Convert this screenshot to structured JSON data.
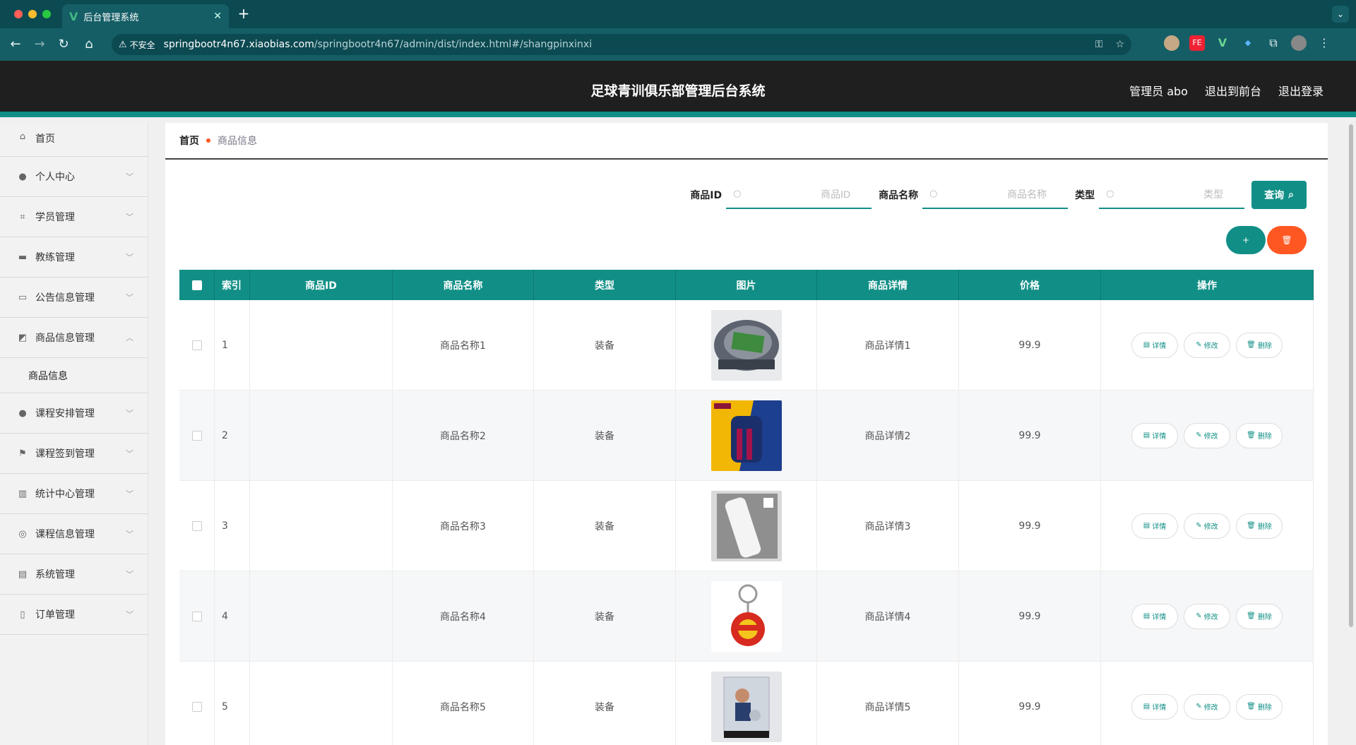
{
  "browser": {
    "tab_title": "后台管理系统",
    "insecure_label": "不安全",
    "url_host": "springbootr4n67.xiaobias.com",
    "url_path": "/springbootr4n67/admin/dist/index.html#/shangpinxinxi"
  },
  "header": {
    "title": "足球青训俱乐部管理后台系统",
    "user": "管理员 abo",
    "to_front": "退出到前台",
    "logout": "退出登录"
  },
  "sidebar": {
    "items": [
      {
        "label": "首页",
        "icon": "home-icon"
      },
      {
        "label": "个人中心",
        "icon": "user-icon"
      },
      {
        "label": "学员管理",
        "icon": "crop-icon"
      },
      {
        "label": "教练管理",
        "icon": "briefcase-icon"
      },
      {
        "label": "公告信息管理",
        "icon": "card-icon"
      },
      {
        "label": "商品信息管理",
        "icon": "chart-icon"
      },
      {
        "label": "课程安排管理",
        "icon": "user-icon"
      },
      {
        "label": "课程签到管理",
        "icon": "flag-icon"
      },
      {
        "label": "统计中心管理",
        "icon": "library-icon"
      },
      {
        "label": "课程信息管理",
        "icon": "compass-icon"
      },
      {
        "label": "系统管理",
        "icon": "clipboard-icon"
      },
      {
        "label": "订单管理",
        "icon": "microphone-icon"
      }
    ],
    "sub_item": "商品信息"
  },
  "breadcrumb": {
    "home": "首页",
    "current": "商品信息"
  },
  "search": {
    "id_label": "商品ID",
    "id_placeholder": "商品ID",
    "name_label": "商品名称",
    "name_placeholder": "商品名称",
    "type_label": "类型",
    "type_placeholder": "类型",
    "query_button": "查询"
  },
  "actions": {
    "add": "+",
    "delete": "🗑"
  },
  "table": {
    "headers": [
      "索引",
      "商品ID",
      "商品名称",
      "类型",
      "图片",
      "商品详情",
      "价格",
      "操作"
    ],
    "rows": [
      {
        "index": "1",
        "id": "",
        "name": "商品名称1",
        "type": "装备",
        "detail": "商品详情1",
        "price": "99.9",
        "img": "stadium"
      },
      {
        "index": "2",
        "id": "",
        "name": "商品名称2",
        "type": "装备",
        "detail": "商品详情2",
        "price": "99.9",
        "img": "backpack"
      },
      {
        "index": "3",
        "id": "",
        "name": "商品名称3",
        "type": "装备",
        "detail": "商品详情3",
        "price": "99.9",
        "img": "bottle"
      },
      {
        "index": "4",
        "id": "",
        "name": "商品名称4",
        "type": "装备",
        "detail": "商品详情4",
        "price": "99.9",
        "img": "keychain"
      },
      {
        "index": "5",
        "id": "",
        "name": "商品名称5",
        "type": "装备",
        "detail": "商品详情5",
        "price": "99.9",
        "img": "figure"
      }
    ],
    "ops": {
      "detail": "详情",
      "edit": "修改",
      "delete": "删除"
    }
  },
  "colors": {
    "accent": "#118f86",
    "danger": "#ff5722",
    "header_bg": "#1f1f1f"
  }
}
